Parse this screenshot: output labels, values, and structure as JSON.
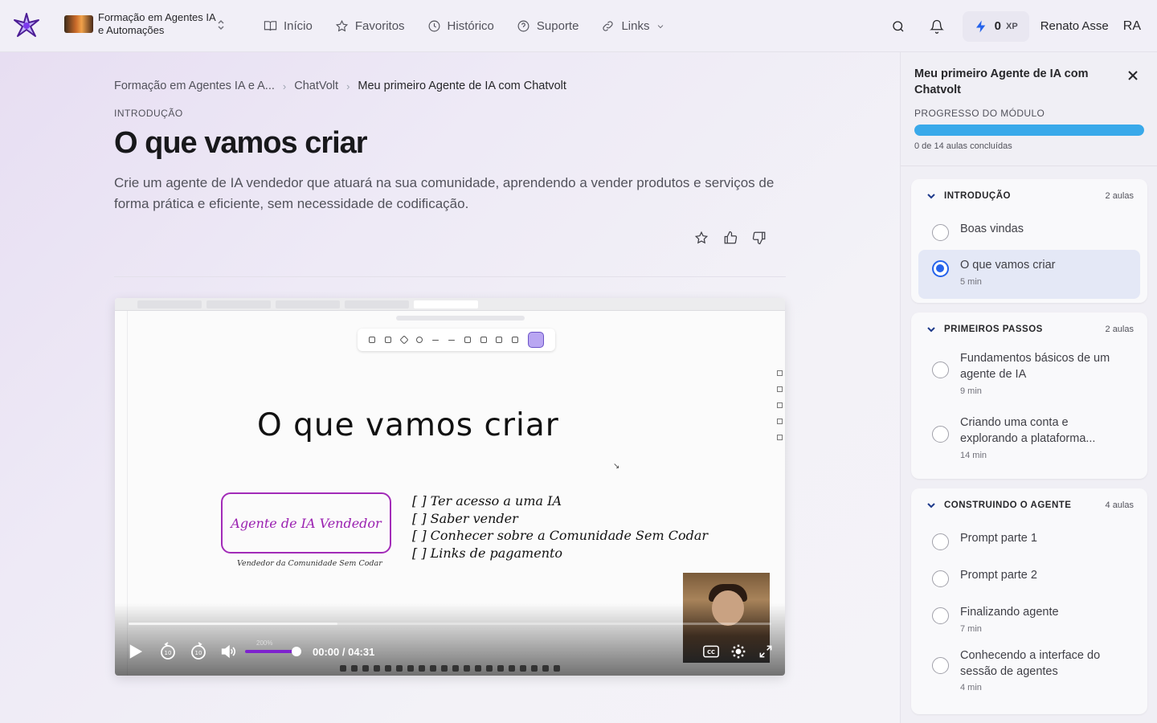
{
  "header": {
    "course_name": "Formação em Agentes IA e Automações",
    "nav": [
      {
        "label": "Início",
        "icon": "book-open-icon"
      },
      {
        "label": "Favoritos",
        "icon": "star-icon"
      },
      {
        "label": "Histórico",
        "icon": "clock-icon"
      },
      {
        "label": "Suporte",
        "icon": "help-circle-icon"
      },
      {
        "label": "Links",
        "icon": "link-icon"
      }
    ],
    "xp_value": "0",
    "xp_unit": "XP",
    "user_name": "Renato Asse",
    "user_initials": "RA"
  },
  "breadcrumb": {
    "course": "Formação em Agentes IA e A...",
    "module": "ChatVolt",
    "lesson": "Meu primeiro Agente de IA com Chatvolt"
  },
  "lesson": {
    "section": "INTRODUÇÃO",
    "title": "O que vamos criar",
    "description": "Crie um agente de IA vendedor que atuará na sua comunidade, aprendendo a vender produtos e serviços de forma prática e eficiente, sem necessidade de codificação."
  },
  "video": {
    "slide_title": "O que vamos criar",
    "agent_box": "Agente de IA Vendedor",
    "agent_sub": "Vendedor da Comunidade Sem Codar",
    "checklist": [
      "[  ] Ter acesso a uma IA",
      "[  ] Saber vender",
      "[  ] Conhecer sobre a Comunidade Sem Codar",
      "[  ] Links de pagamento"
    ],
    "time": "00:00 / 04:31",
    "volume_label": "200%",
    "volume_fraction": 1.0,
    "played_fraction": 0.0
  },
  "panel": {
    "title": "Meu primeiro Agente de IA com Chatvolt",
    "progress_label": "PROGRESSO DO MÓDULO",
    "progress_fraction": 1.0,
    "progress_color": "#39a9ea",
    "progress_count": "0 de 14 aulas concluídas",
    "modules": [
      {
        "name": "INTRODUÇÃO",
        "count": "2 aulas",
        "lessons": [
          {
            "title": "Boas vindas",
            "duration": ""
          },
          {
            "title": "O que vamos criar",
            "duration": "5 min",
            "active": true
          }
        ]
      },
      {
        "name": "PRIMEIROS PASSOS",
        "count": "2 aulas",
        "lessons": [
          {
            "title": "Fundamentos básicos de um agente de IA",
            "duration": "9 min"
          },
          {
            "title": "Criando uma conta e explorando a plataforma...",
            "duration": "14 min"
          }
        ]
      },
      {
        "name": "CONSTRUINDO O AGENTE",
        "count": "4 aulas",
        "lessons": [
          {
            "title": "Prompt parte 1",
            "duration": ""
          },
          {
            "title": "Prompt parte 2",
            "duration": ""
          },
          {
            "title": "Finalizando agente",
            "duration": "7 min"
          },
          {
            "title": "Conhecendo a interface do sessão de agentes",
            "duration": "4 min"
          }
        ]
      }
    ]
  }
}
